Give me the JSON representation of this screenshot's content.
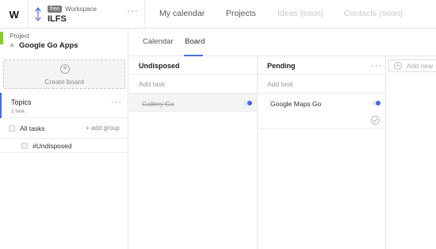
{
  "brand": {
    "logo_letter": "W",
    "accent_color": "#4a6cd4",
    "project_color": "#8cc63f"
  },
  "workspace": {
    "plan_badge": "free",
    "label": "Workspace",
    "name": "ILFS",
    "switch_icon": "switch-arrows-icon",
    "more": "···"
  },
  "topnav": [
    {
      "label": "My calendar",
      "disabled": false
    },
    {
      "label": "Projects",
      "disabled": false
    },
    {
      "label": "Ideas (soon)",
      "disabled": true
    },
    {
      "label": "Contacts (soon)",
      "disabled": true
    }
  ],
  "sidebar": {
    "project_label": "Project",
    "project_name": "Google Go Apps",
    "project_star_icon": "star-icon",
    "create_board_label": "Create board",
    "topics": {
      "name": "Topics",
      "count": "1 task",
      "more": "···"
    },
    "all_tasks_label": "All tasks",
    "add_group_label": "+ add group",
    "groups": [
      {
        "label": "#Undisposed"
      }
    ]
  },
  "tabs": [
    {
      "label": "Calendar",
      "active": false
    },
    {
      "label": "Board",
      "active": true
    }
  ],
  "board": {
    "columns": [
      {
        "title": "Undisposed",
        "add_task": "Add task",
        "cards": [
          {
            "title": "Gallery Go",
            "done": true
          }
        ]
      },
      {
        "title": "Pending",
        "add_task": "Add task",
        "more": "···",
        "cards": [
          {
            "title": "Google Maps Go",
            "done": false
          }
        ]
      }
    ],
    "add_new_label": "Add new"
  }
}
